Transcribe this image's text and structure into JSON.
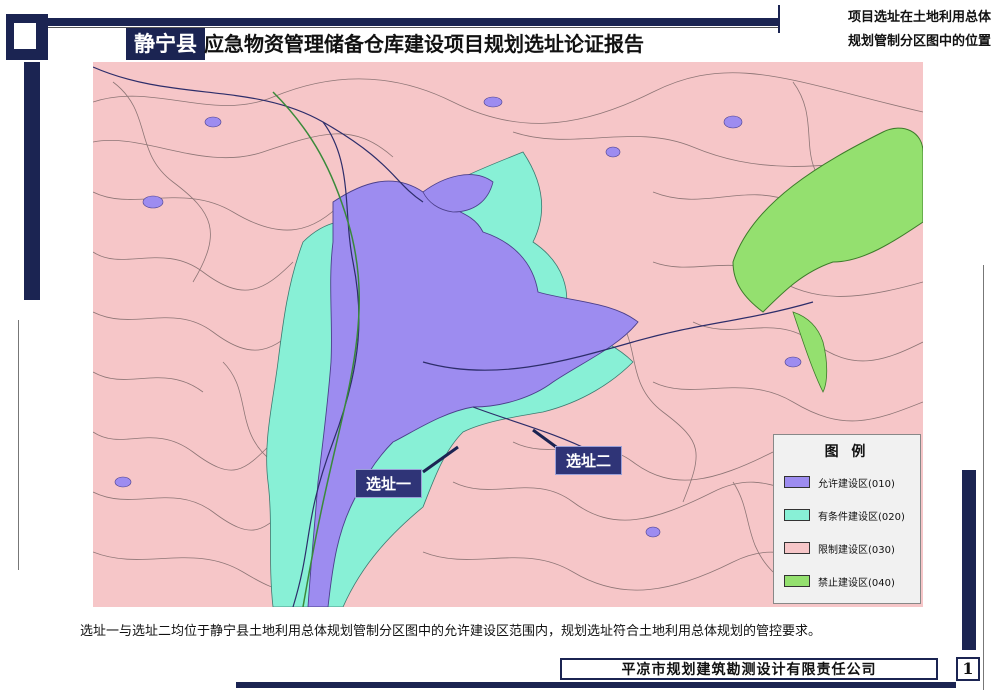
{
  "title": {
    "highlight": "静宁县",
    "rest": "应急物资管理储备仓库建设项目规划选址论证报告"
  },
  "top_right_caption": {
    "line1": "项目选址在土地利用总体",
    "line2": "规划管制分区图中的位置"
  },
  "map": {
    "sites": [
      {
        "label": "选址一"
      },
      {
        "label": "选址二"
      }
    ]
  },
  "legend": {
    "title": "图 例",
    "items": [
      {
        "label": "允许建设区(010)",
        "color": "#9d8cf0"
      },
      {
        "label": "有条件建设区(020)",
        "color": "#88f0d6"
      },
      {
        "label": "限制建设区(030)",
        "color": "#f6c6c8"
      },
      {
        "label": "禁止建设区(040)",
        "color": "#94e06f"
      }
    ]
  },
  "caption": "选址一与选址二均位于静宁县土地利用总体规划管制分区图中的允许建设区范围内，规划选址符合土地利用总体规划的管控要求。",
  "footer": {
    "company": "平凉市规划建筑勘测设计有限责任公司",
    "page": "1"
  },
  "colors": {
    "frame": "#1b2452",
    "allowed": "#9d8cf0",
    "conditional": "#88f0d6",
    "restricted": "#f6c6c8",
    "prohibited": "#94e06f"
  }
}
